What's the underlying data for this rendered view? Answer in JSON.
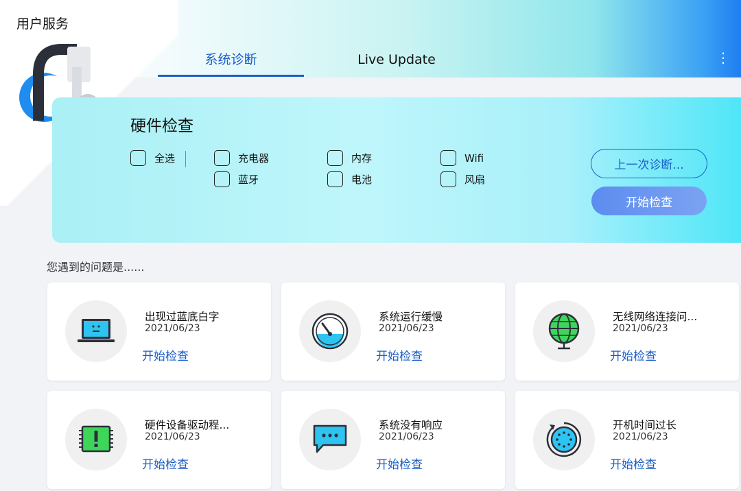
{
  "app": {
    "title": "用户服务"
  },
  "tabs": [
    {
      "label": "系统诊断",
      "active": true
    },
    {
      "label": "Live Update",
      "active": false
    }
  ],
  "menu": {
    "more_glyph": "⋮"
  },
  "hardware_check": {
    "title": "硬件检查",
    "select_all": "全选",
    "items": [
      "充电器",
      "蓝牙",
      "内存",
      "电池",
      "Wifi",
      "风扇"
    ],
    "last_diag_button": "上一次诊断...",
    "start_button": "开始检查"
  },
  "issues": {
    "label": "您遇到的问题是......",
    "cards": [
      {
        "title": "出现过蓝底白字",
        "date": "2021/06/23",
        "action": "开始检查",
        "icon": "laptop-bsod-icon"
      },
      {
        "title": "系统运行缓慢",
        "date": "2021/06/23",
        "action": "开始检查",
        "icon": "gauge-icon"
      },
      {
        "title": "无线网络连接问...",
        "date": "2021/06/23",
        "action": "开始检查",
        "icon": "globe-icon"
      },
      {
        "title": "硬件设备驱动程...",
        "date": "2021/06/23",
        "action": "开始检查",
        "icon": "chip-alert-icon"
      },
      {
        "title": "系统没有响应",
        "date": "2021/06/23",
        "action": "开始检查",
        "icon": "chat-bubble-icon"
      },
      {
        "title": "开机时间过长",
        "date": "2021/06/23",
        "action": "开始检查",
        "icon": "loading-clock-icon"
      }
    ]
  },
  "colors": {
    "accent": "#1a5ec7",
    "start_button": "#6a97f1",
    "screen_blue": "#2ec4f1",
    "chip_green": "#3ed65a"
  }
}
